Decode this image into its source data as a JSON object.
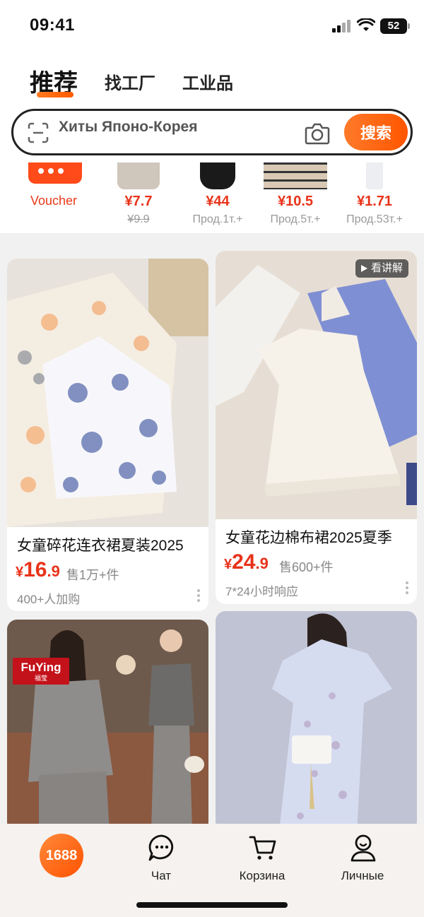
{
  "status": {
    "time": "09:41",
    "battery": "52"
  },
  "tabs": [
    {
      "label": "推荐"
    },
    {
      "label": "找工厂"
    },
    {
      "label": "工业品"
    }
  ],
  "search": {
    "value": "Хиты Японо-Корея",
    "button_label": "搜索"
  },
  "deals": [
    {
      "label": "Voucher",
      "icon": "voucher-icon"
    },
    {
      "price": "¥7.7",
      "sub": "¥9.9"
    },
    {
      "price": "¥44",
      "sub": "Прод.1т.+"
    },
    {
      "price": "¥10.5",
      "sub": "Прод.5т.+"
    },
    {
      "price": "¥1.71",
      "sub": "Прод.53т.+"
    }
  ],
  "products": [
    {
      "title": "女童碎花连衣裙夏装2025",
      "price_symbol": "¥",
      "price_int": "16",
      "price_dec": ".9",
      "sold": "售1万+件",
      "meta": "400+人加购"
    },
    {
      "title": "女童花边棉布裙2025夏季",
      "price_symbol": "¥",
      "price_int": "24",
      "price_dec": ".9",
      "sold": "售600+件",
      "meta": "7*24小时响应",
      "badge": "看讲解"
    },
    {
      "brand": "FuYing",
      "brand_sub": "福莹"
    },
    {}
  ],
  "tab_bar": [
    {
      "label": "1688"
    },
    {
      "label": "Чат"
    },
    {
      "label": "Корзина"
    },
    {
      "label": "Личные"
    }
  ],
  "colors": {
    "accent": "#ff5a00",
    "price": "#e8331a"
  }
}
